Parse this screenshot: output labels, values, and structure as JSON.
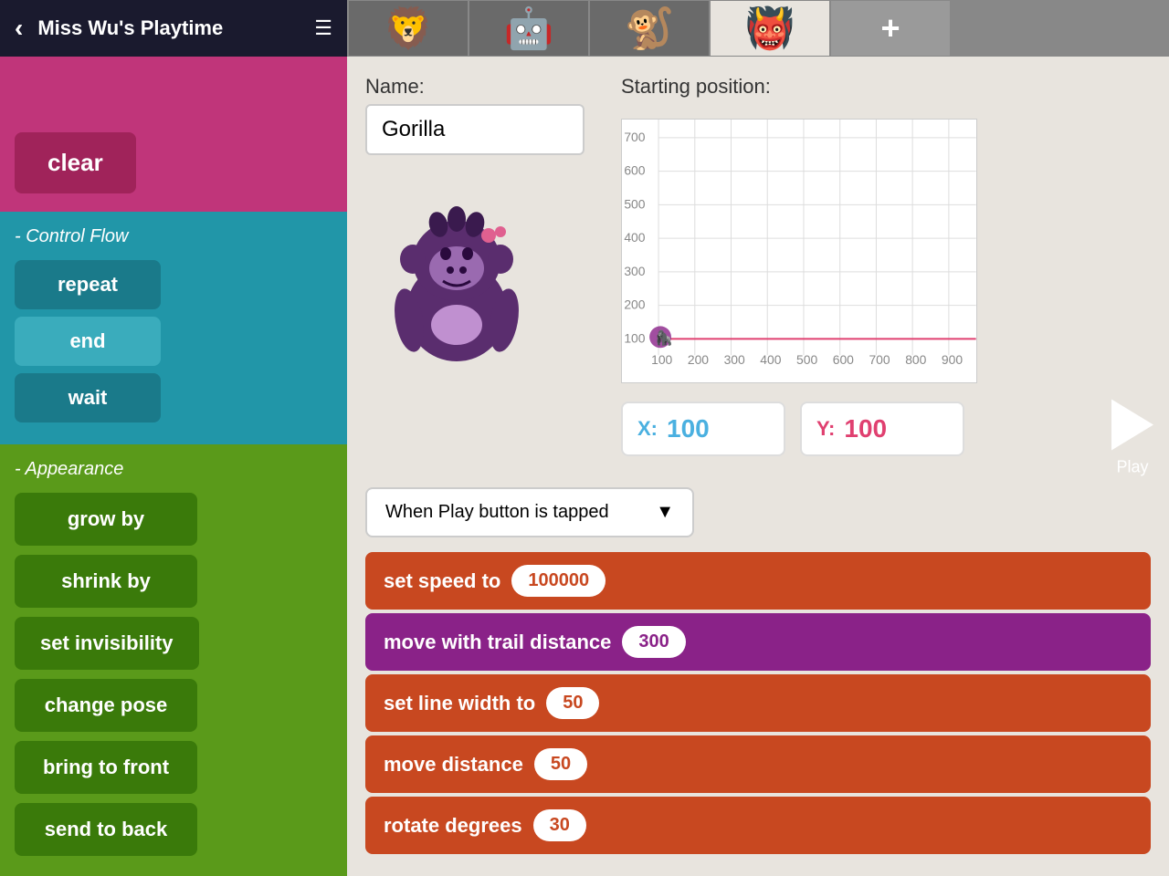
{
  "app": {
    "title": "Miss Wu's Playtime",
    "back_label": "‹",
    "menu_label": "☰"
  },
  "sidebar": {
    "clear_label": "clear",
    "control_flow_label": "- Control Flow",
    "repeat_label": "repeat",
    "end_label": "end",
    "wait_label": "wait",
    "appearance_label": "- Appearance",
    "grow_by_label": "grow by",
    "shrink_by_label": "shrink by",
    "set_invisibility_label": "set invisibility",
    "change_pose_label": "change pose",
    "bring_to_front_label": "bring to front",
    "send_to_back_label": "send to back"
  },
  "characters": [
    {
      "emoji": "🦁",
      "label": "char1"
    },
    {
      "emoji": "🤖",
      "label": "char2"
    },
    {
      "emoji": "🐒",
      "label": "char3"
    },
    {
      "emoji": "👹",
      "label": "char4",
      "selected": true
    }
  ],
  "add_char_label": "+",
  "name_label": "Name:",
  "name_value": "Gorilla",
  "position_label": "Starting position:",
  "grid": {
    "x_labels": [
      "100",
      "200",
      "300",
      "400",
      "500",
      "600",
      "700",
      "800",
      "900"
    ],
    "y_labels": [
      "700",
      "600",
      "500",
      "400",
      "300",
      "200",
      "100"
    ]
  },
  "position": {
    "x_label": "X:",
    "x_value": "100",
    "y_label": "Y:",
    "y_value": "100"
  },
  "trigger": {
    "label": "When Play button is tapped",
    "dropdown_arrow": "▼"
  },
  "blocks": [
    {
      "type": "orange",
      "text": "set speed to",
      "value": "100000",
      "value_color": "orange"
    },
    {
      "type": "purple",
      "text": "move with trail distance",
      "value": "300",
      "value_color": "purple"
    },
    {
      "type": "orange",
      "text": "set line width to",
      "value": "50",
      "value_color": "orange"
    },
    {
      "type": "orange",
      "text": "move distance",
      "value": "50",
      "value_color": "orange"
    },
    {
      "type": "orange",
      "text": "rotate degrees",
      "value": "30",
      "value_color": "orange"
    }
  ],
  "play_label": "Play",
  "accent_colors": {
    "pink": "#c0357a",
    "blue": "#2196a8",
    "green": "#5a9a1a",
    "orange": "#c84820",
    "purple": "#8a2288"
  }
}
